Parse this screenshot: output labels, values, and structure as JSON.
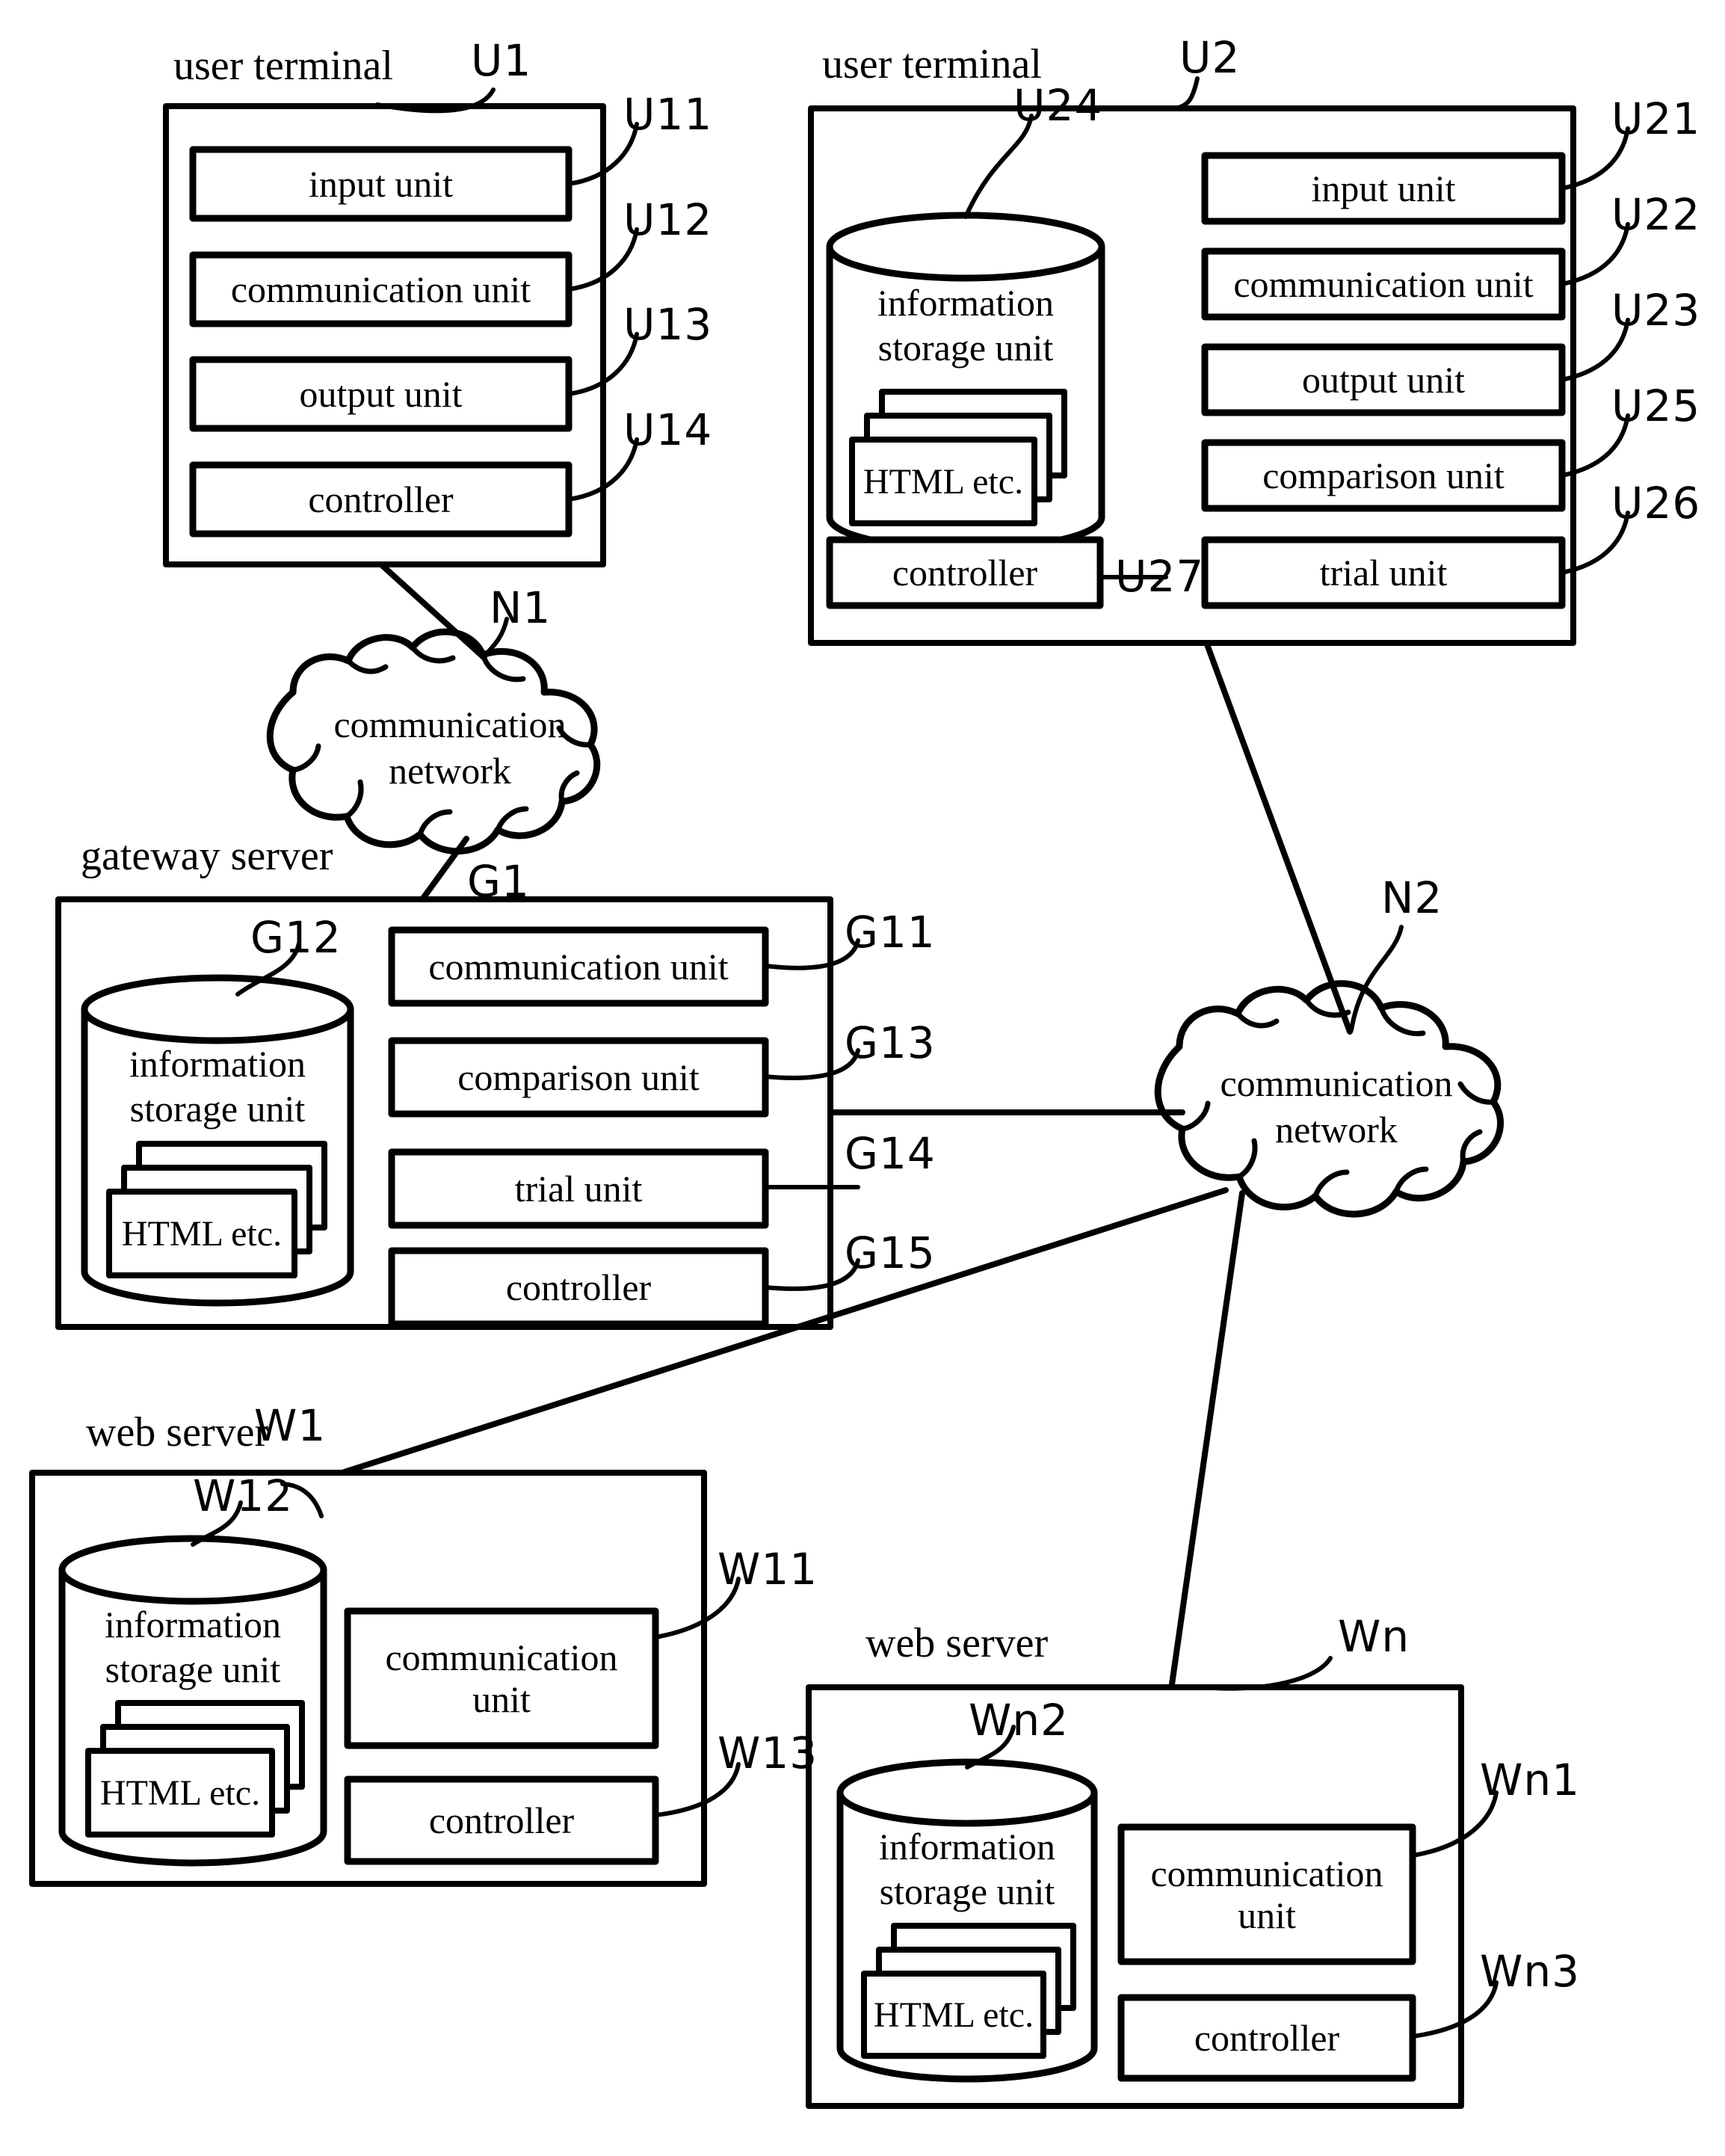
{
  "figure": {
    "type": "patent-system-block-diagram",
    "background": "#ffffff",
    "stroke": "#000000"
  },
  "captions": {
    "user_terminal_1": "user terminal",
    "user_terminal_2": "user terminal",
    "gateway_server": "gateway server",
    "web_server_1": "web server",
    "web_server_n": "web server"
  },
  "refs": {
    "U1": "U1",
    "U11": "U11",
    "U12": "U12",
    "U13": "U13",
    "U14": "U14",
    "U2": "U2",
    "U21": "U21",
    "U22": "U22",
    "U23": "U23",
    "U24": "U24",
    "U25": "U25",
    "U26": "U26",
    "U27": "U27",
    "N1": "N1",
    "N2": "N2",
    "G1": "G1",
    "G11": "G11",
    "G12": "G12",
    "G13": "G13",
    "G14": "G14",
    "G15": "G15",
    "W1": "W1",
    "W11": "W11",
    "W12": "W12",
    "W13": "W13",
    "Wn": "Wn",
    "Wn1": "Wn1",
    "Wn2": "Wn2",
    "Wn3": "Wn3"
  },
  "user_terminal_1": {
    "units": [
      {
        "id": "U11",
        "label": "input unit"
      },
      {
        "id": "U12",
        "label": "communication unit"
      },
      {
        "id": "U13",
        "label": "output unit"
      },
      {
        "id": "U14",
        "label": "controller"
      }
    ]
  },
  "user_terminal_2": {
    "storage": {
      "id": "U24",
      "line1": "information",
      "line2": "storage unit",
      "docs_label": "HTML etc."
    },
    "units": [
      {
        "id": "U21",
        "label": "input unit"
      },
      {
        "id": "U22",
        "label": "communication unit"
      },
      {
        "id": "U23",
        "label": "output unit"
      },
      {
        "id": "U25",
        "label": "comparison unit"
      },
      {
        "id": "U26",
        "label": "trial unit"
      },
      {
        "id": "U27",
        "label": "controller"
      }
    ]
  },
  "gateway_server": {
    "storage": {
      "id": "G12",
      "line1": "information",
      "line2": "storage unit",
      "docs_label": "HTML  etc."
    },
    "units": [
      {
        "id": "G11",
        "label": "communication unit"
      },
      {
        "id": "G13",
        "label": "comparison unit"
      },
      {
        "id": "G14",
        "label": "trial unit"
      },
      {
        "id": "G15",
        "label": "controller"
      }
    ]
  },
  "web_server_1": {
    "storage": {
      "id": "W12",
      "line1": "information",
      "line2": "storage unit",
      "docs_label": "HTML etc."
    },
    "units": [
      {
        "id": "W11",
        "line1": "communication",
        "line2": "unit"
      },
      {
        "id": "W13",
        "label": "controller"
      }
    ]
  },
  "web_server_n": {
    "storage": {
      "id": "Wn2",
      "line1": "information",
      "line2": "storage unit",
      "docs_label": "HTML etc."
    },
    "units": [
      {
        "id": "Wn1",
        "line1": "communication",
        "line2": "unit"
      },
      {
        "id": "Wn3",
        "label": "controller"
      }
    ]
  },
  "networks": {
    "n1": {
      "id": "N1",
      "line1": "communication",
      "line2": "network"
    },
    "n2": {
      "id": "N2",
      "line1": "communication",
      "line2": "network"
    }
  }
}
